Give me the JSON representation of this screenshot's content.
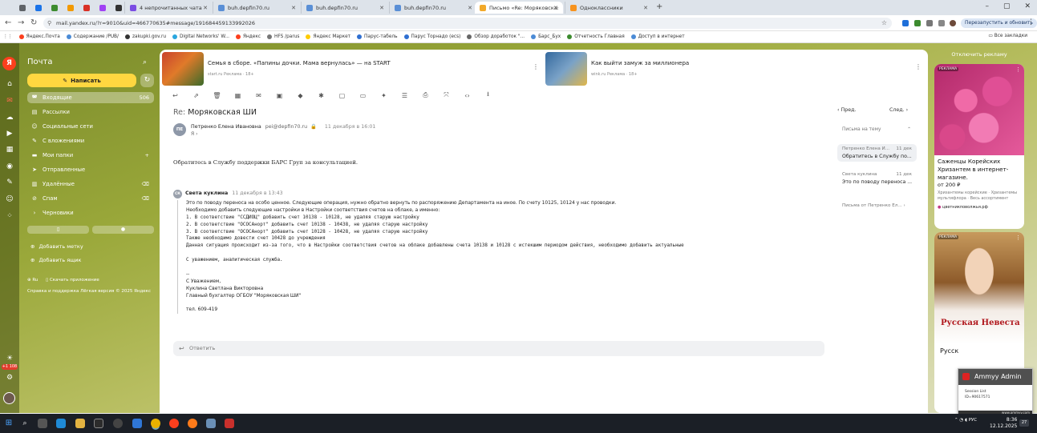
{
  "browser": {
    "tabs": [
      {
        "title": "",
        "color": "#5f6368"
      },
      {
        "title": "",
        "color": "#1a73e8"
      },
      {
        "title": "",
        "color": "#3c8b2e"
      },
      {
        "title": "",
        "color": "#f29900"
      },
      {
        "title": "",
        "color": "#d93025"
      },
      {
        "title": "",
        "color": "#a142f4"
      },
      {
        "title": "",
        "color": "#333333"
      },
      {
        "title": "4 непрочитанных чата",
        "color": "#7b4de3"
      },
      {
        "title": "buh.depfin70.ru",
        "color": "#5a8fd6"
      },
      {
        "title": "buh.depfin70.ru",
        "color": "#5a8fd6"
      },
      {
        "title": "buh.depfin70.ru",
        "color": "#5a8fd6"
      },
      {
        "title": "Письмо «Re: Моряковская ШИ»",
        "color": "#f2a92a"
      },
      {
        "title": "Одноклассники",
        "color": "#f7931e"
      }
    ],
    "url": "mail.yandex.ru/?r=9010&uid=466770635#message/191684459133992026",
    "restart_label": "Перезапустить и обновить",
    "bookmarks": [
      {
        "label": "Яндекс.Почта",
        "color": "#fc3f1d"
      },
      {
        "label": "Содержание /PUB/",
        "color": "#4b8bd6"
      },
      {
        "label": "zakupki.gov.ru",
        "color": "#333333"
      },
      {
        "label": "Digital Networks' W...",
        "color": "#2aa6de"
      },
      {
        "label": "Яндекс",
        "color": "#fc3f1d"
      },
      {
        "label": "HFS /parus",
        "color": "#777777"
      },
      {
        "label": "Яндекс Маркет",
        "color": "#ffcc00"
      },
      {
        "label": "Парус-табель",
        "color": "#2f6fd1"
      },
      {
        "label": "Парус Торнадо (ecs)",
        "color": "#2f6fd1"
      },
      {
        "label": "Обзор доработок \"...",
        "color": "#666666"
      },
      {
        "label": "Барс_Бух",
        "color": "#4b8bd6"
      },
      {
        "label": "Отчетность Главная",
        "color": "#3c8b2e"
      },
      {
        "label": "Доступ в интернет",
        "color": "#4b8bd6"
      }
    ],
    "all_bookmarks": "Все закладки"
  },
  "mail": {
    "brand": "Почта",
    "compose_label": "Написать",
    "folders": [
      {
        "label": "Входящие",
        "count": "506",
        "icon": "◚",
        "active": true
      },
      {
        "label": "Рассылки",
        "count": "",
        "icon": "▤",
        "active": false
      },
      {
        "label": "Социальные сети",
        "count": "",
        "icon": "☺",
        "active": false
      },
      {
        "label": "С вложениями",
        "count": "",
        "icon": "✎",
        "active": false
      },
      {
        "label": "Мои папки",
        "count": "",
        "icon": "▬",
        "active": false
      },
      {
        "label": "Отправленные",
        "count": "",
        "icon": "➤",
        "active": false
      },
      {
        "label": "Удалённые",
        "count": "",
        "icon": "▥",
        "active": false
      },
      {
        "label": "Спам",
        "count": "",
        "icon": "⊘",
        "active": false
      },
      {
        "label": "Черновики",
        "count": "",
        "icon": "›",
        "active": false
      }
    ],
    "add_label": "Добавить метку",
    "add_box": "Добавить ящик",
    "lang": "Ru",
    "download_app": "Скачать приложение",
    "footer": "Справка и поддержка   Лёгкая версия   © 2025 Яндекс",
    "weather_badge": "+1 108"
  },
  "ads_top": [
    {
      "title": "Семья в сборе. «Папины дочки. Мама вернулась» — на START",
      "source": "start.ru  Реклама · 18+",
      "color": "#c9422e"
    },
    {
      "title": "Как выйти замуж за миллионера",
      "source": "wink.ru  Реклама · 18+",
      "color": "#34699e"
    }
  ],
  "toolbar_icons": [
    "↩",
    "⇗",
    "🗑",
    "▦",
    "✉",
    "▣",
    "◆",
    "✱",
    "▢",
    "▭",
    "✦",
    "☰",
    "⎙",
    "⤧",
    "‹›",
    "⭳"
  ],
  "message": {
    "subject_prefix": "Re:",
    "subject": "Моряковская ШИ",
    "sender_initials": "ПЕ",
    "sender_name": "Петренко Елена Ивановна",
    "sender_email": "pei@depfin70.ru",
    "date": "11 декабря в 16:01",
    "to": "Я ›",
    "body": "Обратитесь в Службу поддержки БАРС Груп за консультацией."
  },
  "quoted": {
    "initials": "СК",
    "name": "Света куклина",
    "date": "11 декабря в 13:43",
    "lines": [
      "Это по поводу переноса на особо ценное.  Следующие операция, нужно обратно вернуть по распоряжению Департамента на иное. По счету 10125, 10124 у нас проводки.",
      "Необходимо добавить следующие настройки в Настройки соответствия счетов на облаке, а именно:",
      "1. В соответствие \"ССДИОЦ\" добавить счет 10138 - 10128, не удаляя старую настройку",
      "2. В соответствие \"ОСОСАнорт\" добавить счет 10138 - 10438, не удаляя старую настройку",
      "3. В соответствие \"ОСОСАнорт\" добавить счет 10128 - 10428, не удаляя старую настройку",
      "Также необходимо довести счет 10428 до учреждения",
      "Данная ситуация происходит из-за того, что в Настройки соответствия счетов на облаке добавлены счета 10138 и 10128 с истекшим периодом действия, необходимо добавить актуальные",
      "",
      "С уважением, аналитическая служба.",
      "",
      "--",
      "С Уважением,",
      "Куклина Светлана Викторовна",
      "Главный бухгалтер ОГБОУ \"Моряковская ШИ\"",
      "",
      "тел. 609-419"
    ]
  },
  "reply_label": "Ответить",
  "thread": {
    "prev": "Пред.",
    "next": "След.",
    "title": "Письма на тему",
    "items": [
      {
        "from": "Петренко Елена И...",
        "date": "11 дек",
        "snippet": "Обратитесь в Службу по...",
        "selected": true
      },
      {
        "from": "Света куклина",
        "date": "11 дек",
        "snippet": "Это по поводу переноса ...",
        "selected": false
      }
    ],
    "more": "Письма от Петренко Ел... ›"
  },
  "right_ads": {
    "disable": "Отключить рекламу",
    "ad1": {
      "label": "РЕКЛАМА",
      "title": "Саженцы Корейских Хризантем в интернет-магазине.",
      "price": "от 200 ₽",
      "desc": "Хризантемы корейские · Хризантемы мультифлора · Весь ассортимент",
      "source": "цветникповолжья.рф"
    },
    "ad2": {
      "label": "РЕКЛАМА",
      "brand": "Русская Невеста",
      "caption": "Русск"
    }
  },
  "ammyy": {
    "title": "Ammyy Admin",
    "session": "Session List",
    "id": "ID=90617571",
    "url": "www.ammyy.com"
  },
  "taskbar": {
    "lang": "РУС",
    "time": "8:36",
    "date": "12.12.2025",
    "badge": "27"
  }
}
